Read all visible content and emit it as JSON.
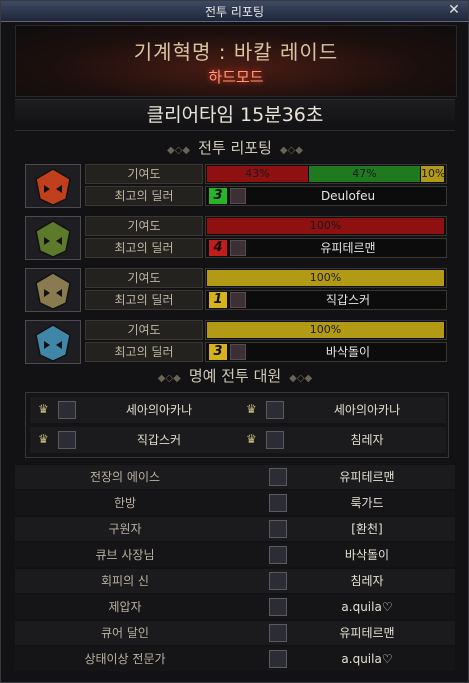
{
  "window": {
    "title": "전투 리포팅",
    "close": "✕"
  },
  "banner": {
    "raid": "기계혁명 : 바칼 레이드",
    "mode": "하드모드"
  },
  "clear": {
    "text": "클리어타임  15분36초"
  },
  "report_title": "전투 리포팅",
  "party": [
    {
      "contrib_label": "기여도",
      "dealer_label": "최고의 딜러",
      "segments": [
        {
          "pct": 43,
          "text": "43%",
          "color": "#8e1010"
        },
        {
          "pct": 47,
          "text": "47%",
          "color": "#1f7a1f"
        },
        {
          "pct": 10,
          "text": "10%",
          "color": "#b39a14"
        }
      ],
      "rank": "3",
      "rank_color": "#26b526",
      "dealer": "Deulofeu",
      "portrait": "party-1-helmet-icon",
      "accent": "#c0401c"
    },
    {
      "contrib_label": "기여도",
      "dealer_label": "최고의 딜러",
      "segments": [
        {
          "pct": 100,
          "text": "100%",
          "color": "#8e1010"
        }
      ],
      "rank": "4",
      "rank_color": "#c21c1c",
      "dealer": "유피테르맨",
      "portrait": "party-2-helmet-icon",
      "accent": "#5c7a2a"
    },
    {
      "contrib_label": "기여도",
      "dealer_label": "최고의 딜러",
      "segments": [
        {
          "pct": 100,
          "text": "100%",
          "color": "#b39a14"
        }
      ],
      "rank": "1",
      "rank_color": "#d6b21c",
      "dealer": "직갑스커",
      "portrait": "party-3-helmet-icon",
      "accent": "#8a7a50"
    },
    {
      "contrib_label": "기여도",
      "dealer_label": "최고의 딜러",
      "segments": [
        {
          "pct": 100,
          "text": "100%",
          "color": "#b39a14"
        }
      ],
      "rank": "3",
      "rank_color": "#d6b21c",
      "dealer": "바삭돌이",
      "portrait": "party-4-helmet-icon",
      "accent": "#3f86a8"
    }
  ],
  "honor_title": "명예 전투 대원",
  "honor": [
    {
      "name": "세아의아카나"
    },
    {
      "name": "세아의아카나"
    },
    {
      "name": "직갑스커"
    },
    {
      "name": "침레자"
    }
  ],
  "awards": [
    {
      "title": "전장의 에이스",
      "name": "유피테르맨"
    },
    {
      "title": "한방",
      "name": "룩가드"
    },
    {
      "title": "구원자",
      "name": "[환천]"
    },
    {
      "title": "큐브 사장님",
      "name": "바삭돌이"
    },
    {
      "title": "회피의 신",
      "name": "침레자"
    },
    {
      "title": "제압자",
      "name": "a.quila♡"
    },
    {
      "title": "큐어 달인",
      "name": "유피테르맨"
    },
    {
      "title": "상태이상 전문가",
      "name": "a.quila♡"
    }
  ]
}
